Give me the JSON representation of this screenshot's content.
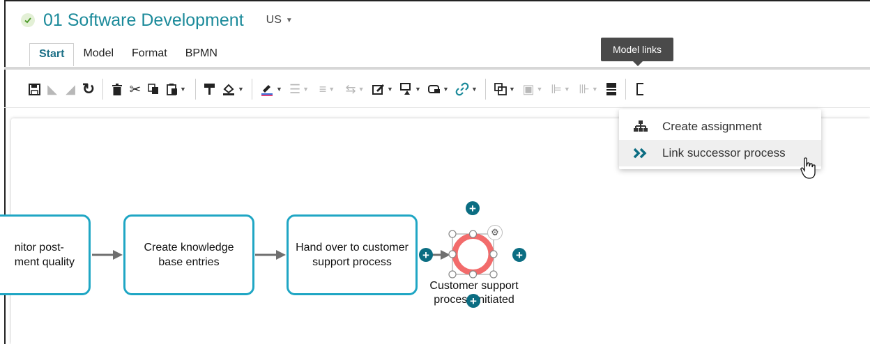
{
  "header": {
    "title": "01 Software Development",
    "language": "US"
  },
  "tabs": [
    {
      "label": "Start"
    },
    {
      "label": "Model"
    },
    {
      "label": "Format"
    },
    {
      "label": "BPMN"
    }
  ],
  "tooltip": "Model links",
  "menu": {
    "items": [
      {
        "label": "Create assignment",
        "icon": "assignment-hierarchy-icon"
      },
      {
        "label": "Link successor process",
        "icon": "double-chevron-right-icon"
      }
    ]
  },
  "diagram": {
    "tasks": [
      {
        "label": "nitor post-\nment quality"
      },
      {
        "label": "Create knowledge\nbase entries"
      },
      {
        "label": "Hand over to customer\nsupport process"
      }
    ],
    "end_event_label": "Customer support\nprocess initiated"
  },
  "colors": {
    "accent": "#1fa6c4",
    "title": "#1b8a9a",
    "end_event": "#f26b6b",
    "handle": "#0b6d82"
  }
}
